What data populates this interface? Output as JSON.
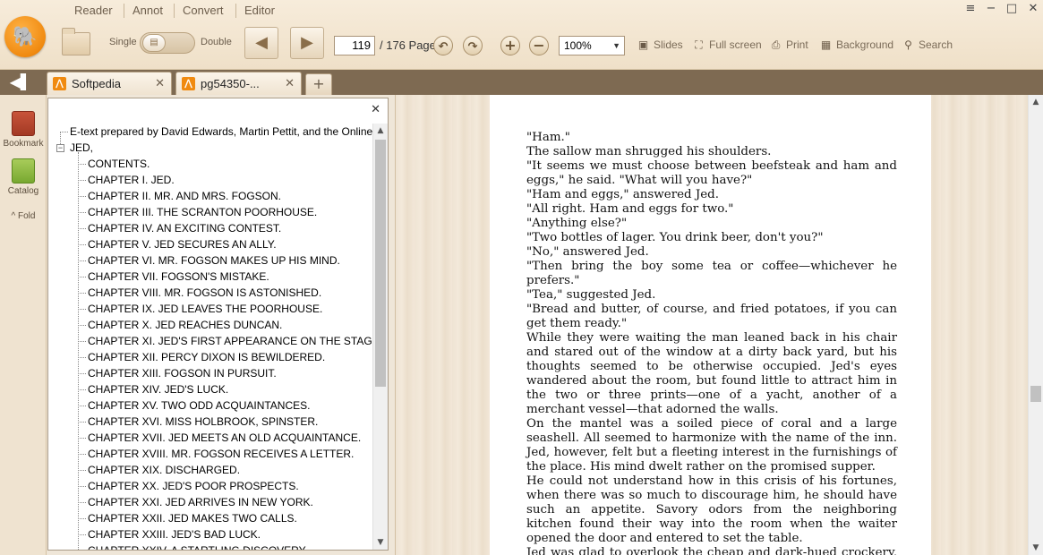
{
  "menu": {
    "tabs": [
      "Reader",
      "Annot",
      "Convert",
      "Editor"
    ]
  },
  "window": {
    "menu_glyph": "≡",
    "minimize_glyph": "−",
    "maximize_glyph": "□",
    "close_glyph": "✕"
  },
  "toolbar": {
    "single_label": "Single",
    "double_label": "Double",
    "current_page": "119",
    "total_pages": "/ 176 Page",
    "zoom_value": "100%",
    "slides_label": "Slides",
    "fullscreen_label": "Full screen",
    "print_label": "Print",
    "background_label": "Background",
    "search_label": "Search",
    "icons": [
      "open-folder-icon",
      "page-toggle-icon",
      "previous-page-icon",
      "next-page-icon",
      "undo-icon",
      "redo-icon",
      "zoom-in-icon",
      "zoom-out-icon",
      "slides-icon",
      "full-screen-icon",
      "print-icon",
      "background-icon",
      "search-icon"
    ]
  },
  "tabs": {
    "items": [
      {
        "label": "Softpedia",
        "close": "✕"
      },
      {
        "label": "pg54350-...",
        "close": "✕"
      }
    ],
    "new_tab": "+"
  },
  "rail": {
    "bookmark_label": "Bookmark",
    "catalog_label": "Catalog",
    "fold_label": "Fold"
  },
  "catalog": {
    "close": "✕",
    "root_entry": "E-text prepared by David Edwards, Martin Pettit, and the Online I",
    "parent_entry": "JED,",
    "entries": [
      "CONTENTS.",
      "CHAPTER I. JED.",
      "CHAPTER II. MR. AND MRS. FOGSON.",
      "CHAPTER III. THE SCRANTON POORHOUSE.",
      "CHAPTER IV. AN EXCITING CONTEST.",
      "CHAPTER V. JED SECURES AN ALLY.",
      "CHAPTER VI. MR. FOGSON MAKES UP HIS MIND.",
      "CHAPTER VII. FOGSON'S MISTAKE.",
      "CHAPTER VIII. MR. FOGSON IS ASTONISHED.",
      "CHAPTER IX. JED LEAVES THE POORHOUSE.",
      "CHAPTER X. JED REACHES DUNCAN.",
      "CHAPTER XI. JED'S FIRST APPEARANCE ON THE STAGE.",
      "CHAPTER XII. PERCY DIXON IS BEWILDERED.",
      "CHAPTER XIII. FOGSON IN PURSUIT.",
      "CHAPTER XIV. JED'S LUCK.",
      "CHAPTER XV. TWO ODD ACQUAINTANCES.",
      "CHAPTER XVI. MISS HOLBROOK, SPINSTER.",
      "CHAPTER XVII. JED MEETS AN OLD ACQUAINTANCE.",
      "CHAPTER XVIII. MR. FOGSON RECEIVES A LETTER.",
      "CHAPTER XIX. DISCHARGED.",
      "CHAPTER XX. JED'S POOR PROSPECTS.",
      "CHAPTER XXI. JED ARRIVES IN NEW YORK.",
      "CHAPTER XXII. JED MAKES TWO CALLS.",
      "CHAPTER XXIII. JED'S BAD LUCK.",
      "CHAPTER XXIV. A STARTLING DISCOVERY."
    ]
  },
  "document": {
    "paragraphs": [
      "\"Ham.\"",
      "The sallow man shrugged his shoulders.",
      "\"It seems we must choose between beefsteak and ham and eggs,\" he said. \"What will you have?\"",
      "\"Ham and eggs,\" answered Jed.",
      "\"All right. Ham and eggs for two.\"",
      "\"Anything else?\"",
      "\"Two bottles of lager. You drink beer, don't you?\"",
      "\"No,\" answered Jed.",
      "\"Then bring the boy some tea or coffee—whichever he prefers.\"",
      "\"Tea,\" suggested Jed.",
      "\"Bread and butter, of course, and fried potatoes, if you can get them ready.\"",
      "While they were waiting the man leaned back in his chair and stared out of the window at a dirty back yard, but his thoughts seemed to be otherwise occupied. Jed's eyes wandered about the room, but found little to attract him in the two or three prints—one of a yacht, another of a merchant vessel—that adorned the walls.",
      "On the mantel was a soiled piece of coral and a large seashell. All seemed to harmonize with the name of the inn. Jed, however, felt but a fleeting interest in the furnishings of the place. His mind dwelt rather on the promised supper.",
      "He could not understand how in this crisis of his fortunes, when there was so much to discourage him, he should have such an appetite. Savory odors from the neighboring kitchen found their way into the room when the waiter opened the door and entered to set the table.",
      "Jed was glad to overlook the cheap and dark-hued crockery, the rusty knives and forks, and the chipped glasses on the"
    ]
  }
}
